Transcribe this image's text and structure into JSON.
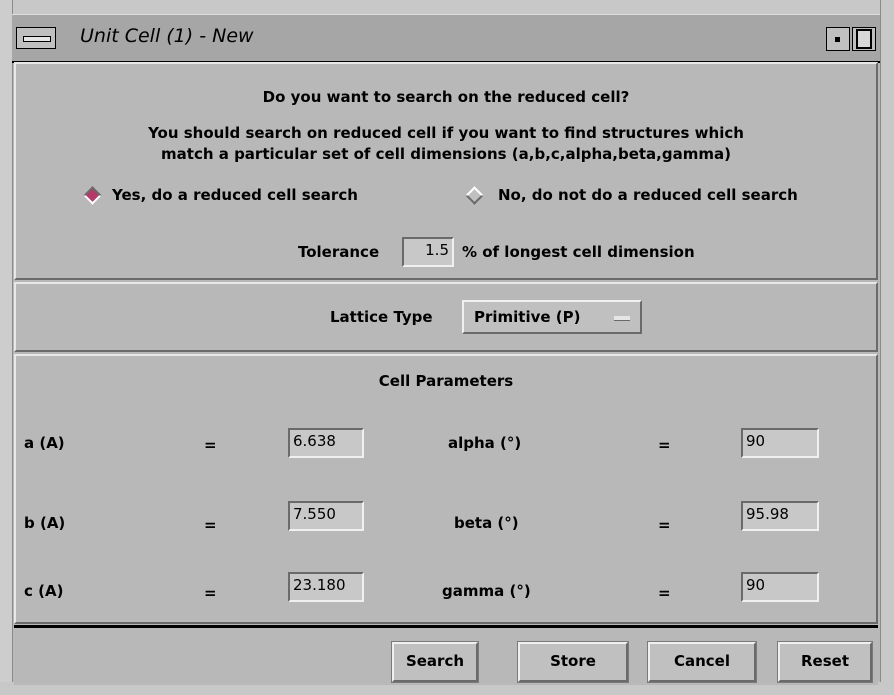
{
  "window": {
    "title": "Unit Cell (1) - New"
  },
  "reduced_cell": {
    "question": "Do you want to search on the reduced cell?",
    "help_line1": "You should search on reduced cell if you want to find structures which",
    "help_line2": "match a particular set of cell dimensions (a,b,c,alpha,beta,gamma)",
    "option_yes": "Yes, do a reduced cell search",
    "option_no": "No, do not do a reduced cell search",
    "selected": "yes",
    "tolerance_label": "Tolerance",
    "tolerance_value": "1.5",
    "tolerance_suffix": "% of longest cell dimension"
  },
  "lattice": {
    "label": "Lattice Type",
    "selected": "Primitive (P)"
  },
  "cell_parameters": {
    "heading": "Cell Parameters",
    "equals": "=",
    "a_label": "a (A)",
    "a_value": "6.638",
    "b_label": "b (A)",
    "b_value": "7.550",
    "c_label": "c (A)",
    "c_value": "23.180",
    "alpha_label": "alpha (°)",
    "alpha_value": "90",
    "beta_label": "beta (°)",
    "beta_value": "95.98",
    "gamma_label": "gamma (°)",
    "gamma_value": "90"
  },
  "buttons": {
    "search": "Search",
    "store": "Store",
    "cancel": "Cancel",
    "reset": "Reset"
  },
  "colors": {
    "selected_radio": "#b43a6a",
    "panel_bg": "#b8b8b8"
  }
}
